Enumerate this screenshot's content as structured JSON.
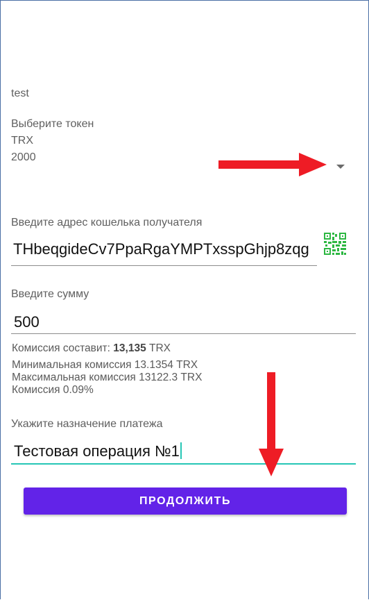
{
  "account_name": "test",
  "token_select": {
    "label": "Выберите токен",
    "symbol": "TRX",
    "balance": "2000"
  },
  "address": {
    "label": "Введите адрес кошелька получателя",
    "value": "THbeqgideCv7PpaRgaYMPTxsspGhjp8zqg",
    "qr_icon": "qr-code-icon",
    "qr_color": "#2db742"
  },
  "amount": {
    "label": "Введите сумму",
    "value": "500"
  },
  "commission": {
    "prefix": "Комиссия составит: ",
    "value": "13,135",
    "unit": " TRX",
    "min": "Минимальная комиссия 13.1354 TRX",
    "max": "Максимальная комиссия 13122.3 TRX",
    "percent": "Комиссия 0.09%"
  },
  "purpose": {
    "label": "Укажите назначение платежа",
    "value": "Тестовая операция №1",
    "accent_color": "#26c6b5"
  },
  "continue_button": {
    "label": "ПРОДОЛЖИТЬ",
    "color": "#6223e8"
  },
  "annotations": {
    "arrow_color": "#ee1c25"
  }
}
